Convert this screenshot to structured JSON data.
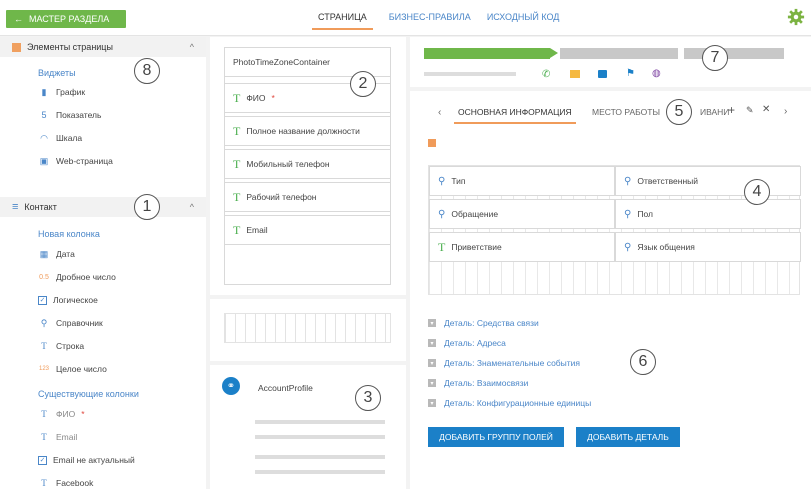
{
  "topbar": {
    "back_label": "МАСТЕР РАЗДЕЛА",
    "tabs": [
      "СТРАНИЦА",
      "БИЗНЕС-ПРАВИЛА",
      "ИСХОДНЫЙ КОД"
    ]
  },
  "left": {
    "page_elements": {
      "header": "Элементы страницы",
      "group": "Виджеты",
      "items": [
        {
          "icon": "bar-chart-icon",
          "label": "График"
        },
        {
          "icon": "number-five-icon",
          "label": "Показатель"
        },
        {
          "icon": "gauge-icon",
          "label": "Шкала"
        },
        {
          "icon": "webpage-icon",
          "label": "Web-страница"
        }
      ]
    },
    "contact": {
      "header": "Контакт",
      "new_group": "Новая колонка",
      "new_items": [
        {
          "icon": "calendar-icon",
          "label": "Дата"
        },
        {
          "icon": "decimal-icon",
          "glyph": "0.5",
          "label": "Дробное число"
        },
        {
          "icon": "checkbox-icon",
          "label": "Логическое"
        },
        {
          "icon": "lookup-icon",
          "label": "Справочник"
        },
        {
          "icon": "text-icon",
          "label": "Строка"
        },
        {
          "icon": "integer-icon",
          "glyph": "123",
          "label": "Целое число"
        }
      ],
      "existing_group": "Существующие колонки",
      "existing_items": [
        {
          "icon": "text-icon",
          "label": "ФИО",
          "required": "*"
        },
        {
          "icon": "text-icon",
          "label": "Email"
        },
        {
          "icon": "checkbox-icon",
          "label": "Email не актуальный"
        },
        {
          "icon": "text-icon",
          "label": "Facebook"
        }
      ]
    }
  },
  "middle": {
    "container_label": "PhotoTimeZoneContainer",
    "fields": [
      {
        "label": "ФИО",
        "required": "*"
      },
      {
        "label": "Полное название должности"
      },
      {
        "label": "Мобильный телефон"
      },
      {
        "label": "Рабочий телефон"
      },
      {
        "label": "Email"
      }
    ],
    "account_profile": "AccountProfile"
  },
  "right": {
    "tabs": [
      "ОСНОВНАЯ ИНФОРМАЦИЯ",
      "МЕСТО РАБОТЫ",
      "ИВАНИ"
    ],
    "grid_fields": [
      {
        "icon": "lookup-icon",
        "label": "Тип"
      },
      {
        "icon": "lookup-icon",
        "label": "Ответственный"
      },
      {
        "icon": "lookup-icon",
        "label": "Обращение"
      },
      {
        "icon": "lookup-icon",
        "label": "Пол"
      },
      {
        "icon": "text-icon",
        "label": "Приветствие"
      },
      {
        "icon": "lookup-icon",
        "label": "Язык общения"
      }
    ],
    "details": [
      "Деталь: Средства связи",
      "Деталь: Адреса",
      "Деталь: Знаменательные события",
      "Деталь: Взаимосвязи",
      "Деталь: Конфигурационные единицы"
    ],
    "add_group_label": "ДОБАВИТЬ ГРУППУ ПОЛЕЙ",
    "add_detail_label": "ДОБАВИТЬ ДЕТАЛЬ"
  },
  "callouts": [
    "1",
    "2",
    "3",
    "4",
    "5",
    "6",
    "7",
    "8"
  ],
  "colors": {
    "accent_green": "#6fb74a",
    "link_blue": "#4a86c8",
    "button_blue": "#1b80c8",
    "tab_orange": "#f09b5a"
  }
}
